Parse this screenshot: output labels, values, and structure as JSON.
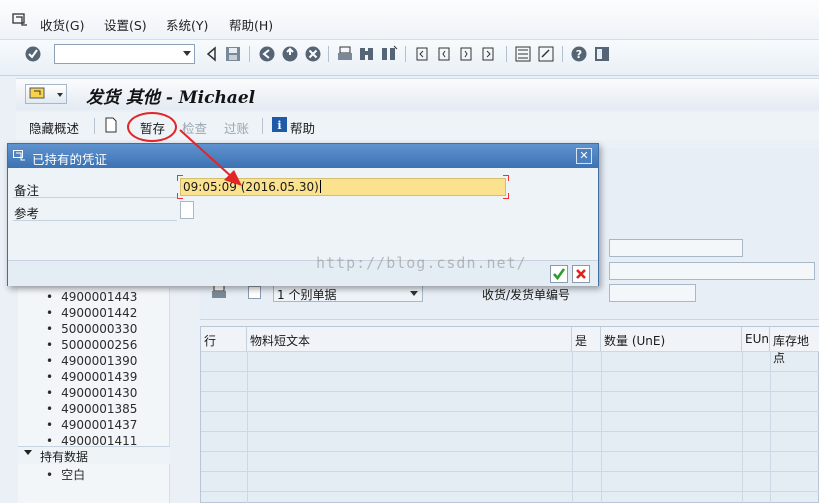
{
  "menubar": {
    "items": [
      "收货(G)",
      "设置(S)",
      "系统(Y)",
      "帮助(H)"
    ]
  },
  "toolbar": {
    "command_field_value": "",
    "icons": [
      "enter-icon",
      "save-icon",
      "back-icon",
      "exit-icon",
      "cancel-icon",
      "print-icon",
      "find-icon",
      "find-next-icon",
      "first-page-icon",
      "prev-page-icon",
      "next-page-icon",
      "last-page-icon",
      "new-session-icon",
      "shortcut-icon",
      "help-icon",
      "layout-icon"
    ]
  },
  "title": {
    "text": "发货 其他 - Michael"
  },
  "apptoolbar": {
    "hide_overview": "隐藏概述",
    "hold": "暂存",
    "check": "检查",
    "post": "过账",
    "help": "帮助"
  },
  "dialog": {
    "title": "已持有的凭证",
    "remark_label": "备注",
    "remark_value": "09:05:09 (2016.05.30)",
    "reference_label": "参考",
    "reference_value": "",
    "close_symbol": "✕"
  },
  "background": {
    "doc_type_select": "1 个别单据",
    "doc_number_label": "收货/发货单编号",
    "tree_items": [
      "4900001443",
      "4900001442",
      "5000000330",
      "5000000256",
      "4900001390",
      "4900001439",
      "4900001430",
      "4900001385",
      "4900001437",
      "4900001411"
    ],
    "held_data_label": "持有数据",
    "empty_label": "空白",
    "grid_headers": [
      "行",
      "物料短文本",
      "是",
      "数量 (UnE)",
      "EUn",
      "库存地点"
    ]
  },
  "watermark": "http://blog.csdn.net/",
  "colors": {
    "dialog_title": "#3d72b3",
    "remark_field": "#fbe28f",
    "annotation_red": "#e32525"
  }
}
